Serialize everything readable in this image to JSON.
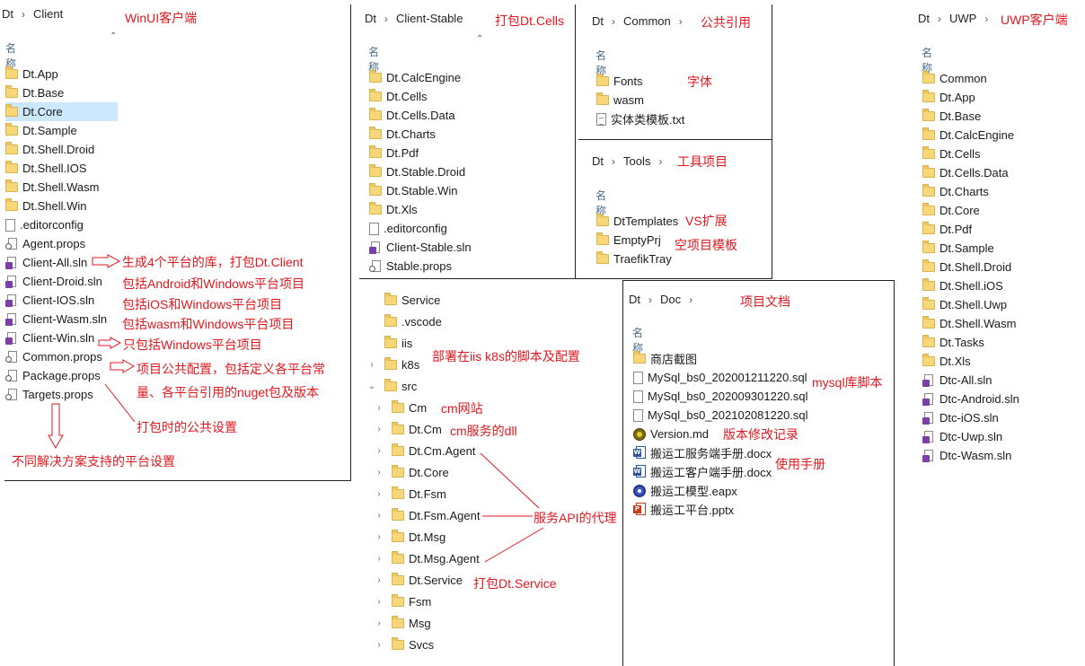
{
  "column_name": "名称",
  "panels": {
    "client": {
      "crumb": [
        "Dt",
        "Client"
      ],
      "items": [
        {
          "label": "Dt.App",
          "icon": "folder-icon"
        },
        {
          "label": "Dt.Base",
          "icon": "folder-icon"
        },
        {
          "label": "Dt.Core",
          "icon": "folder-icon",
          "selected": true
        },
        {
          "label": "Dt.Sample",
          "icon": "folder-icon"
        },
        {
          "label": "Dt.Shell.Droid",
          "icon": "folder-icon"
        },
        {
          "label": "Dt.Shell.IOS",
          "icon": "folder-icon"
        },
        {
          "label": "Dt.Shell.Wasm",
          "icon": "folder-icon"
        },
        {
          "label": "Dt.Shell.Win",
          "icon": "folder-icon"
        },
        {
          "label": ".editorconfig",
          "icon": "file-icon"
        },
        {
          "label": "Agent.props",
          "icon": "props-file-icon"
        },
        {
          "label": "Client-All.sln",
          "icon": "solution-file-icon"
        },
        {
          "label": "Client-Droid.sln",
          "icon": "solution-file-icon"
        },
        {
          "label": "Client-IOS.sln",
          "icon": "solution-file-icon"
        },
        {
          "label": "Client-Wasm.sln",
          "icon": "solution-file-icon"
        },
        {
          "label": "Client-Win.sln",
          "icon": "solution-file-icon"
        },
        {
          "label": "Common.props",
          "icon": "props-file-icon"
        },
        {
          "label": "Package.props",
          "icon": "props-file-icon"
        },
        {
          "label": "Targets.props",
          "icon": "props-file-icon"
        }
      ]
    },
    "client_stable": {
      "crumb": [
        "Dt",
        "Client-Stable"
      ],
      "items": [
        {
          "label": "Dt.CalcEngine",
          "icon": "folder-icon"
        },
        {
          "label": "Dt.Cells",
          "icon": "folder-icon"
        },
        {
          "label": "Dt.Cells.Data",
          "icon": "folder-icon"
        },
        {
          "label": "Dt.Charts",
          "icon": "folder-icon"
        },
        {
          "label": "Dt.Pdf",
          "icon": "folder-icon"
        },
        {
          "label": "Dt.Stable.Droid",
          "icon": "folder-icon"
        },
        {
          "label": "Dt.Stable.Win",
          "icon": "folder-icon"
        },
        {
          "label": "Dt.Xls",
          "icon": "folder-icon"
        },
        {
          "label": ".editorconfig",
          "icon": "file-icon"
        },
        {
          "label": "Client-Stable.sln",
          "icon": "solution-file-icon"
        },
        {
          "label": "Stable.props",
          "icon": "props-file-icon"
        }
      ]
    },
    "common": {
      "crumb": [
        "Dt",
        "Common"
      ],
      "items": [
        {
          "label": "Fonts",
          "icon": "folder-icon"
        },
        {
          "label": "wasm",
          "icon": "folder-icon"
        },
        {
          "label": "实体类模板.txt",
          "icon": "text-file-icon"
        }
      ]
    },
    "tools": {
      "crumb": [
        "Dt",
        "Tools"
      ],
      "items": [
        {
          "label": "DtTemplates",
          "icon": "folder-icon"
        },
        {
          "label": "EmptyPrj",
          "icon": "folder-icon"
        },
        {
          "label": "TraefikTray",
          "icon": "folder-icon"
        }
      ]
    },
    "uwp": {
      "crumb": [
        "Dt",
        "UWP"
      ],
      "items": [
        {
          "label": "Common",
          "icon": "folder-icon"
        },
        {
          "label": "Dt.App",
          "icon": "folder-icon"
        },
        {
          "label": "Dt.Base",
          "icon": "folder-icon"
        },
        {
          "label": "Dt.CalcEngine",
          "icon": "folder-icon"
        },
        {
          "label": "Dt.Cells",
          "icon": "folder-icon"
        },
        {
          "label": "Dt.Cells.Data",
          "icon": "folder-icon"
        },
        {
          "label": "Dt.Charts",
          "icon": "folder-icon"
        },
        {
          "label": "Dt.Core",
          "icon": "folder-icon"
        },
        {
          "label": "Dt.Pdf",
          "icon": "folder-icon"
        },
        {
          "label": "Dt.Sample",
          "icon": "folder-icon"
        },
        {
          "label": "Dt.Shell.Droid",
          "icon": "folder-icon"
        },
        {
          "label": "Dt.Shell.iOS",
          "icon": "folder-icon"
        },
        {
          "label": "Dt.Shell.Uwp",
          "icon": "folder-icon"
        },
        {
          "label": "Dt.Shell.Wasm",
          "icon": "folder-icon"
        },
        {
          "label": "Dt.Tasks",
          "icon": "folder-icon"
        },
        {
          "label": "Dt.Xls",
          "icon": "folder-icon"
        },
        {
          "label": "Dtc-All.sln",
          "icon": "solution-file-icon"
        },
        {
          "label": "Dtc-Android.sln",
          "icon": "solution-file-icon"
        },
        {
          "label": "Dtc-iOS.sln",
          "icon": "solution-file-icon"
        },
        {
          "label": "Dtc-Uwp.sln",
          "icon": "solution-file-icon"
        },
        {
          "label": "Dtc-Wasm.sln",
          "icon": "solution-file-icon"
        }
      ]
    },
    "doc": {
      "crumb": [
        "Dt",
        "Doc"
      ],
      "items": [
        {
          "label": "商店截图",
          "icon": "folder-icon"
        },
        {
          "label": "MySql_bs0_202001211220.sql",
          "icon": "file-icon"
        },
        {
          "label": "MySql_bs0_202009301220.sql",
          "icon": "file-icon"
        },
        {
          "label": "MySql_bs0_202102081220.sql",
          "icon": "file-icon"
        },
        {
          "label": "Version.md",
          "icon": "markdown-file-icon"
        },
        {
          "label": "搬运工服务端手册.docx",
          "icon": "word-doc-icon"
        },
        {
          "label": "搬运工客户端手册.docx",
          "icon": "word-doc-icon"
        },
        {
          "label": "搬运工模型.eapx",
          "icon": "ea-model-icon"
        },
        {
          "label": "搬运工平台.pptx",
          "icon": "powerpoint-icon"
        }
      ]
    },
    "service_tree": {
      "items": [
        {
          "label": "Service",
          "caret": ""
        },
        {
          "label": ".vscode",
          "caret": ""
        },
        {
          "label": "iis",
          "caret": ""
        },
        {
          "label": "k8s",
          "caret": "›"
        },
        {
          "label": "src",
          "caret": "⌄"
        },
        {
          "label": "Cm",
          "caret": "›"
        },
        {
          "label": "Dt.Cm",
          "caret": "›"
        },
        {
          "label": "Dt.Cm.Agent",
          "caret": "›"
        },
        {
          "label": "Dt.Core",
          "caret": "›"
        },
        {
          "label": "Dt.Fsm",
          "caret": "›"
        },
        {
          "label": "Dt.Fsm.Agent",
          "caret": "›"
        },
        {
          "label": "Dt.Msg",
          "caret": "›"
        },
        {
          "label": "Dt.Msg.Agent",
          "caret": "›"
        },
        {
          "label": "Dt.Service",
          "caret": "›"
        },
        {
          "label": "Fsm",
          "caret": "›"
        },
        {
          "label": "Msg",
          "caret": "›"
        },
        {
          "label": "Svcs",
          "caret": "›"
        }
      ]
    }
  },
  "annotations": {
    "winui_client": "WinUI客户端",
    "pack_cells": "打包Dt.Cells",
    "common_ref": "公共引用",
    "fonts": "字体",
    "uwp_client": "UWP客户端",
    "tools_project": "工具项目",
    "vs_ext": "VS扩展",
    "empty_template": "空项目模板",
    "all_platforms": "生成4个平台的库，打包Dt.Client",
    "droid": "包括Android和Windows平台项目",
    "ios": "包括iOS和Windows平台项目",
    "wasm": "包括wasm和Windows平台项目",
    "win": "只包括Windows平台项目",
    "common_props_1": "项目公共配置，包括定义各平台常",
    "common_props_2": "量、各平台引用的nuget包及版本",
    "package_props": "打包时的公共设置",
    "targets_props": "不同解决方案支持的平台设置",
    "iis_k8s": "部署在iis k8s的脚本及配置",
    "cm_site": "cm网站",
    "cm_dll": "cm服务的dll",
    "agent_proxy": "服务API的代理",
    "pack_service": "打包Dt.Service",
    "project_doc": "项目文档",
    "mysql_script": "mysql库脚本",
    "version_log": "版本修改记录",
    "manual": "使用手册"
  },
  "colors": {
    "annotation": "#e0191f",
    "folder": "#f7d77a",
    "selected_row": "#cce8ff"
  }
}
